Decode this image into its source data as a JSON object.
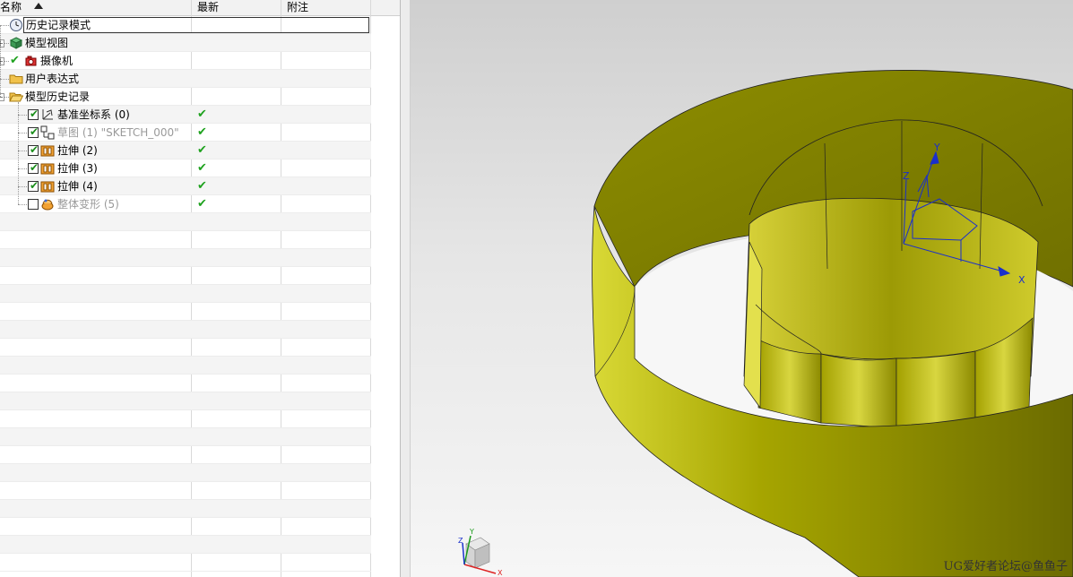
{
  "navigator": {
    "columns": {
      "name": "名称",
      "latest": "最新",
      "comment": "附注"
    },
    "items": [
      {
        "label": "历史记录模式",
        "icon": "clock-icon",
        "dim": false,
        "selected": true
      },
      {
        "label": "模型视图",
        "icon": "model-view-icon",
        "dim": false
      },
      {
        "label": "摄像机",
        "icon": "camera-icon",
        "dim": false
      },
      {
        "label": "用户表达式",
        "icon": "folder-icon",
        "dim": false
      },
      {
        "label": "模型历史记录",
        "icon": "folder-open-icon",
        "dim": false
      },
      {
        "label": "基准坐标系 (0)",
        "icon": "datum-csys-icon",
        "checked": true,
        "latest": "✔",
        "dim": false
      },
      {
        "label": "草图 (1) \"SKETCH_000\"",
        "icon": "sketch-icon",
        "checked": true,
        "latest": "✔",
        "dim": true
      },
      {
        "label": "拉伸 (2)",
        "icon": "extrude-icon",
        "checked": true,
        "latest": "✔",
        "dim": false
      },
      {
        "label": "拉伸 (3)",
        "icon": "extrude-icon",
        "checked": true,
        "latest": "✔",
        "dim": false
      },
      {
        "label": "拉伸 (4)",
        "icon": "extrude-icon",
        "checked": true,
        "latest": "✔",
        "dim": false
      },
      {
        "label": "整体变形 (5)",
        "icon": "global-shaping-icon",
        "checked": false,
        "latest": "✔",
        "dim": true
      }
    ]
  },
  "viewport": {
    "model_color": "#b3b300",
    "csys_labels": {
      "x": "X",
      "y": "Y",
      "z": "Z"
    },
    "triad_labels": {
      "x": "X",
      "y": "Y",
      "z": "Z"
    },
    "watermark": "UG爱好者论坛@鱼鱼子"
  }
}
